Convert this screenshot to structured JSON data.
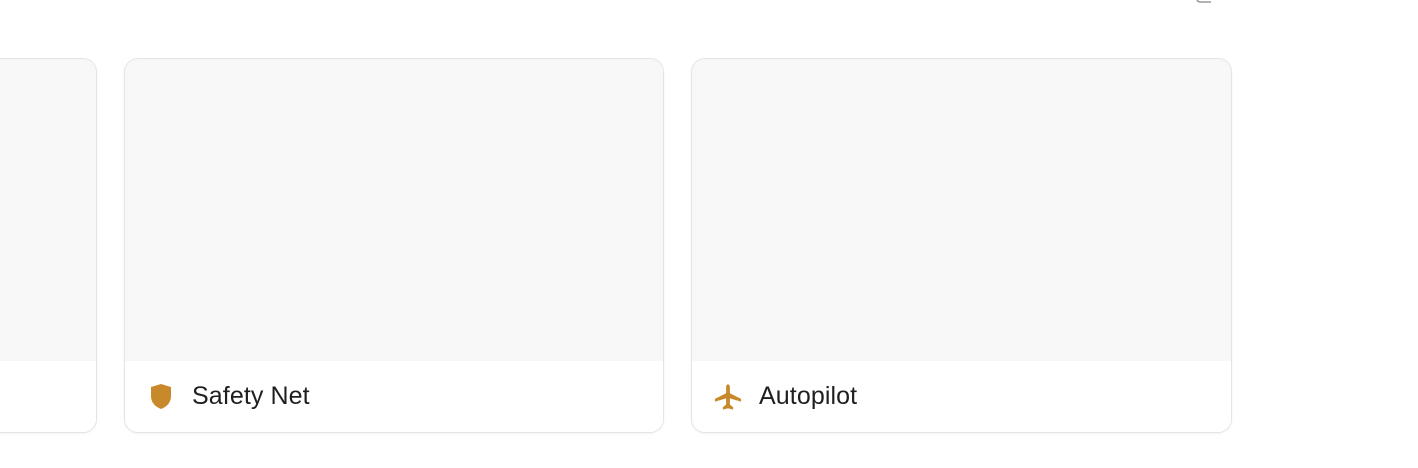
{
  "colors": {
    "accent": "#c8892b",
    "card_border": "#e4e4e4",
    "preview_bg": "#f8f8f8",
    "text": "#1f1f1f"
  },
  "top_toolbar": {
    "icon": "partially-visible-icon"
  },
  "cards": [
    {
      "title": "",
      "icon": "none"
    },
    {
      "title": "Safety Net",
      "icon": "shield-icon"
    },
    {
      "title": "Autopilot",
      "icon": "airplane-icon"
    }
  ]
}
